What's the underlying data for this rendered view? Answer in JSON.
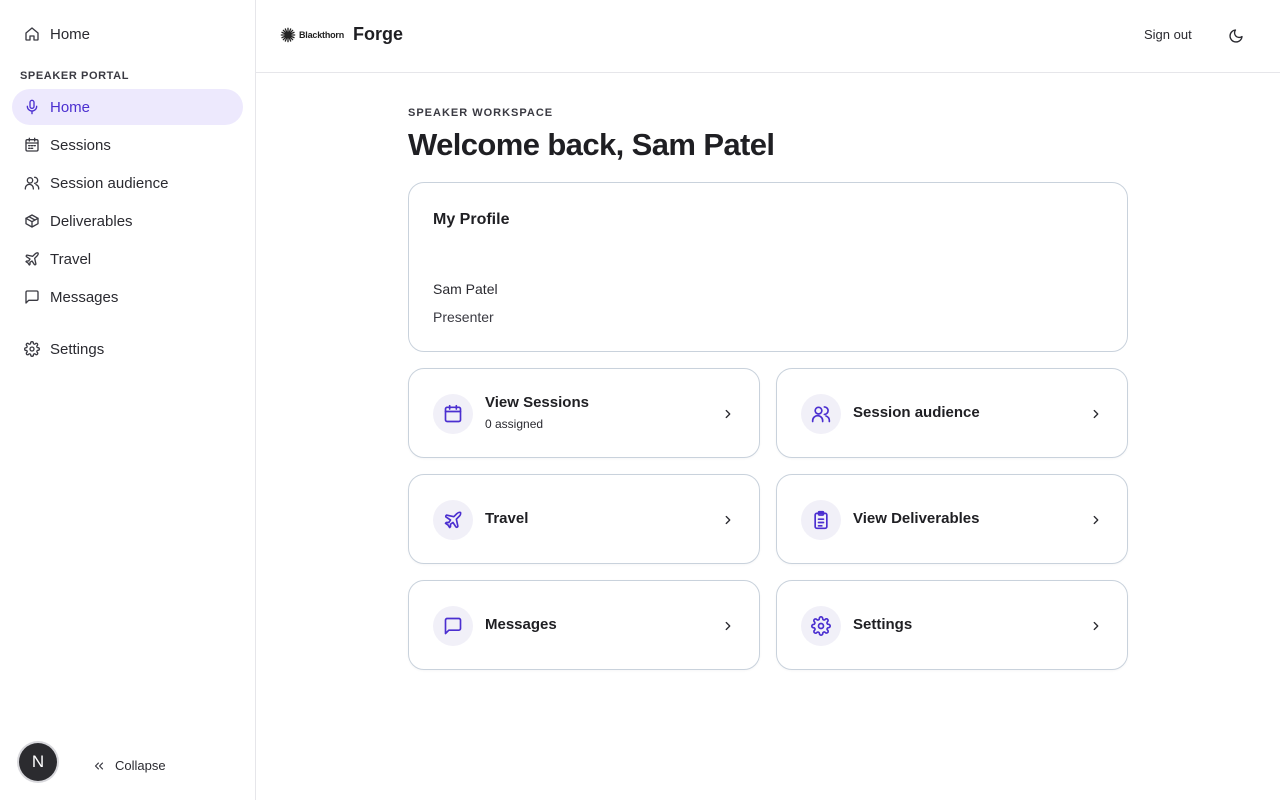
{
  "sidebar": {
    "top_item": {
      "label": "Home",
      "icon": "home-icon"
    },
    "section_label": "SPEAKER PORTAL",
    "items": [
      {
        "label": "Home",
        "icon": "microphone-icon",
        "active": true
      },
      {
        "label": "Sessions",
        "icon": "calendar-icon"
      },
      {
        "label": "Session audience",
        "icon": "users-icon"
      },
      {
        "label": "Deliverables",
        "icon": "package-icon"
      },
      {
        "label": "Travel",
        "icon": "plane-icon"
      },
      {
        "label": "Messages",
        "icon": "message-icon"
      }
    ],
    "settings": {
      "label": "Settings",
      "icon": "gear-icon"
    },
    "avatar_initial": "N",
    "collapse_label": "Collapse"
  },
  "header": {
    "company": "Blackthorn",
    "product": "Forge",
    "signout_label": "Sign out"
  },
  "main": {
    "eyebrow": "SPEAKER WORKSPACE",
    "title": "Welcome back, Sam Patel",
    "profile": {
      "title": "My Profile",
      "name": "Sam Patel",
      "role": "Presenter"
    },
    "tiles": [
      {
        "title": "View Sessions",
        "subtitle": "0 assigned",
        "icon": "calendar-icon"
      },
      {
        "title": "Session audience",
        "icon": "users-icon"
      },
      {
        "title": "Travel",
        "icon": "plane-icon"
      },
      {
        "title": "View Deliverables",
        "icon": "clipboard-icon"
      },
      {
        "title": "Messages",
        "icon": "message-icon"
      },
      {
        "title": "Settings",
        "icon": "gear-icon"
      }
    ]
  },
  "colors": {
    "accent": "#4b2fd0",
    "active_nav_bg": "#ede9fd",
    "card_border": "#c9d2dc"
  }
}
